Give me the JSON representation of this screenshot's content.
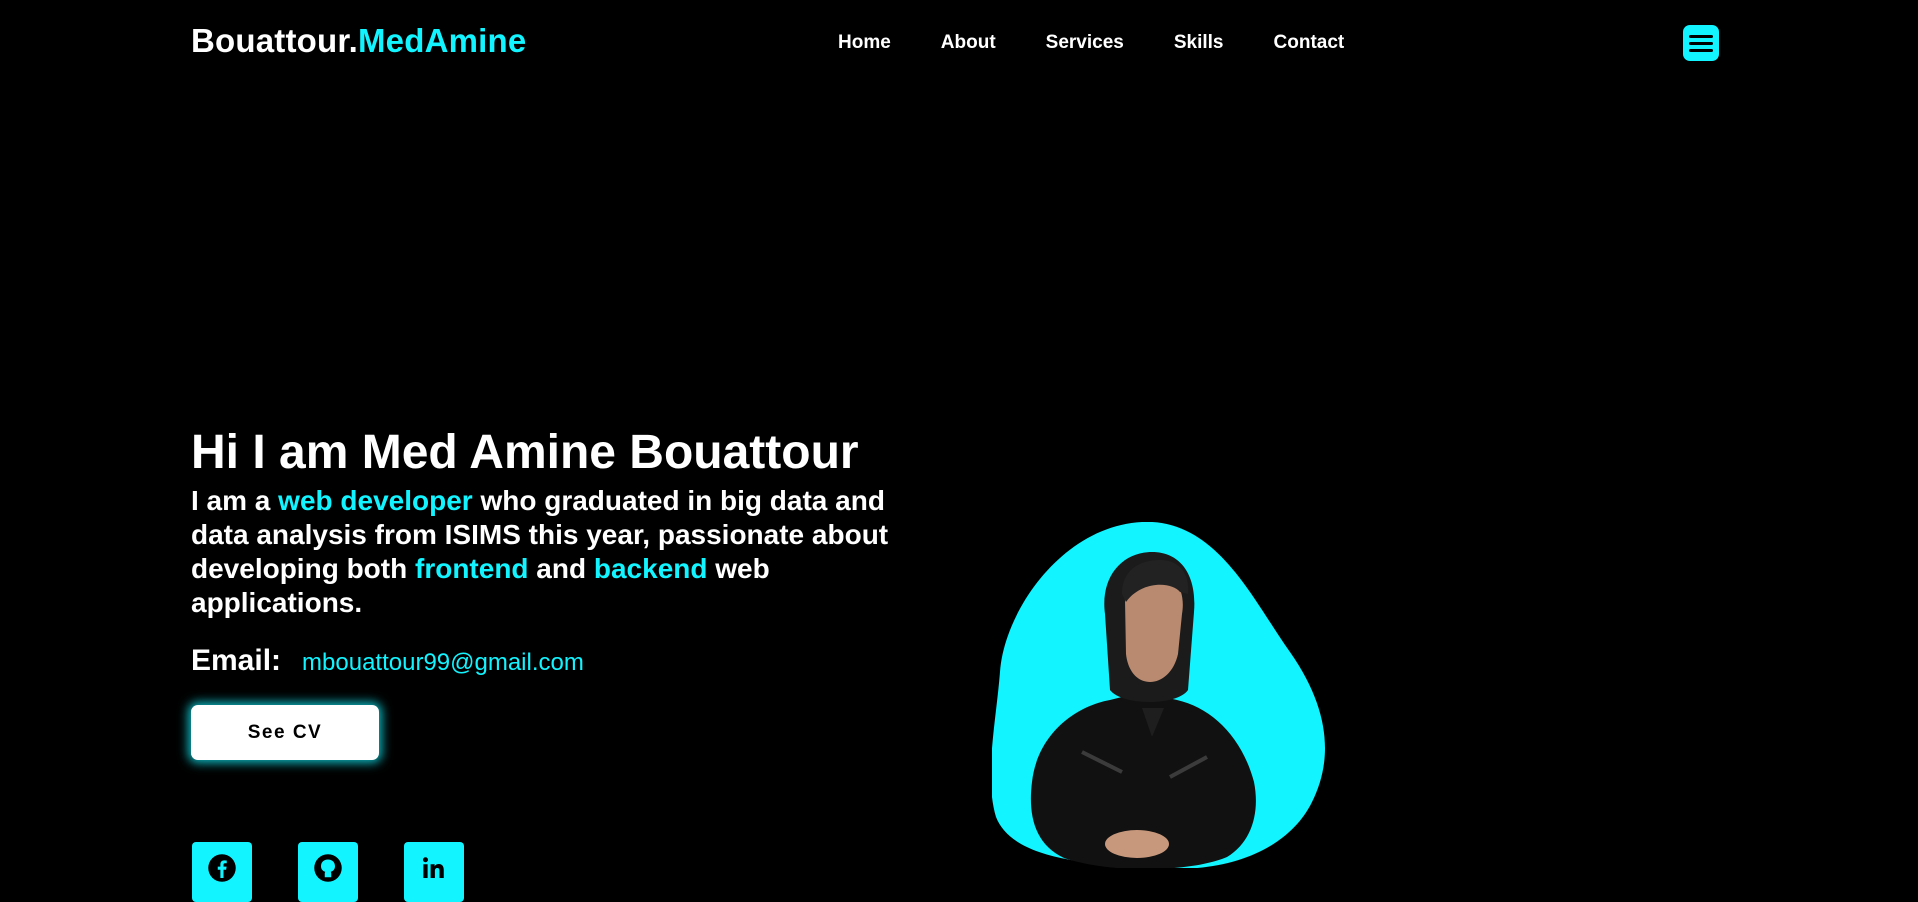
{
  "header": {
    "logo_part1": "Bouattour.",
    "logo_part2": "MedAmine",
    "nav": [
      "Home",
      "About",
      "Services",
      "Skills",
      "Contact"
    ],
    "menu_icon": "hamburger-menu-icon"
  },
  "hero": {
    "title": "Hi I am Med Amine Bouattour",
    "desc": {
      "p1": "I am a ",
      "h1": "web developer",
      "p2": " who graduated in big data and data analysis from ISIMS this year, passionate about developing both ",
      "h2": "frontend",
      "p3": " and ",
      "h3": "backend",
      "p4": " web applications."
    },
    "email_label": "Email:",
    "email_value": "mbouattour99@gmail.com",
    "cv_button": "See CV",
    "socials": [
      "facebook-icon",
      "github-icon",
      "linkedin-icon"
    ]
  },
  "colors": {
    "background": "#000000",
    "accent": "#12f4ff",
    "text": "#ffffff"
  }
}
